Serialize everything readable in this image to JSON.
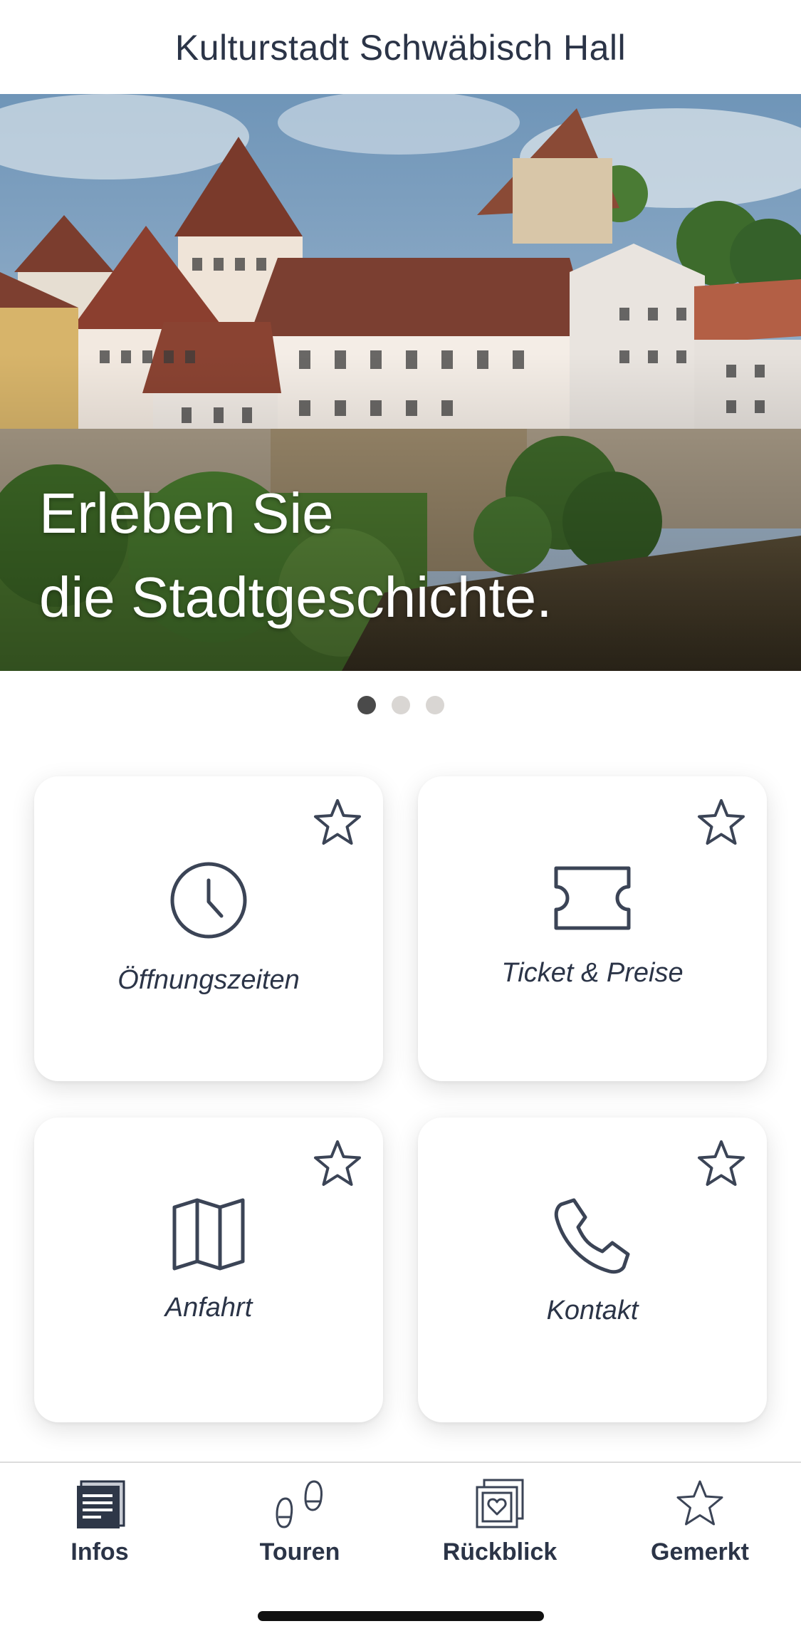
{
  "header": {
    "title": "Kulturstadt Schwäbisch Hall"
  },
  "hero": {
    "line1": "Erleben Sie",
    "line2": "die Stadtgeschichte."
  },
  "pager": {
    "count": 3,
    "active_index": 0
  },
  "tiles": [
    {
      "label": "Öffnungszeiten",
      "icon": "clock-icon",
      "favorite": false
    },
    {
      "label": "Ticket & Preise",
      "icon": "ticket-icon",
      "favorite": false
    },
    {
      "label": "Anfahrt",
      "icon": "map-icon",
      "favorite": false
    },
    {
      "label": "Kontakt",
      "icon": "phone-icon",
      "favorite": false
    }
  ],
  "nav": {
    "items": [
      {
        "label": "Infos",
        "icon": "document-icon",
        "active": true
      },
      {
        "label": "Touren",
        "icon": "footprints-icon",
        "active": false
      },
      {
        "label": "Rückblick",
        "icon": "photo-heart-icon",
        "active": false
      },
      {
        "label": "Gemerkt",
        "icon": "star-icon",
        "active": false
      }
    ]
  },
  "colors": {
    "text": "#2b3447",
    "dot_active": "#4a4a4a",
    "dot_inactive": "#d9d6d3"
  }
}
